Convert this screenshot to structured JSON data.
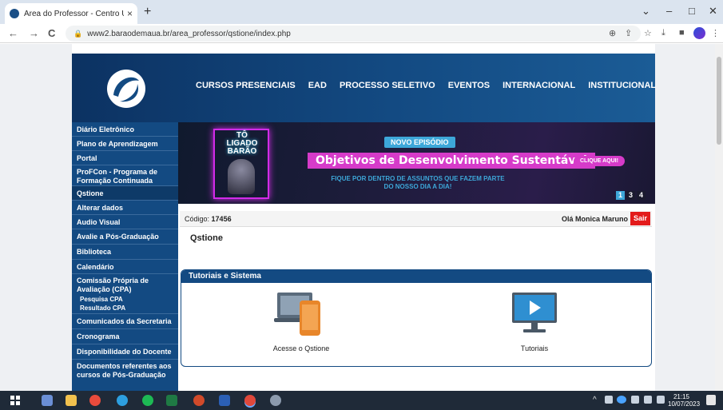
{
  "browser": {
    "tab_title": "Área do Professor - Centro Unive",
    "tab_close": "×",
    "new_tab": "+",
    "url": "www2.baraodemaua.br/area_professor/qstione/index.php",
    "window_controls": {
      "chevron": "⌄",
      "minimize": "–",
      "maximize": "□",
      "close": "✕"
    },
    "nav": {
      "back": "←",
      "forward": "→",
      "reload": "C"
    },
    "toolbar_icons": {
      "zoom": "⊕",
      "share": "⇪",
      "star": "☆",
      "download": "⤓",
      "sidepanel": "■",
      "menu": "⋮"
    }
  },
  "header": {
    "nav_items": [
      "CURSOS PRESENCIAIS",
      "EAD",
      "PROCESSO SELETIVO",
      "EVENTOS",
      "INTERNACIONAL",
      "INSTITUCIONAL"
    ]
  },
  "sidebar": {
    "items": [
      {
        "label": "Diário Eletrônico",
        "type": "item"
      },
      {
        "label": "Plano de Aprendizagem",
        "type": "item"
      },
      {
        "label": "Portal",
        "type": "item"
      },
      {
        "label": "ProFCon - Programa de Formação Continuada",
        "type": "item"
      },
      {
        "label": "Qstione",
        "type": "item",
        "selected": true
      },
      {
        "label": "Alterar dados",
        "type": "item"
      },
      {
        "label": "Audio Visual",
        "type": "item"
      },
      {
        "label": "Avalie a Pós-Graduação",
        "type": "item"
      },
      {
        "label": "Biblioteca",
        "type": "item"
      },
      {
        "label": "Calendário",
        "type": "item"
      },
      {
        "label": "Comissão Própria de Avaliação (CPA)",
        "type": "item"
      },
      {
        "label": "Pesquisa CPA",
        "type": "sub"
      },
      {
        "label": "Resultado CPA",
        "type": "sub"
      },
      {
        "label": "Comunicados da Secretaria",
        "type": "item"
      },
      {
        "label": "Cronograma",
        "type": "item"
      },
      {
        "label": "Disponibilidade do Docente",
        "type": "item"
      },
      {
        "label": "Documentos referentes aos cursos de Pós-Graduação",
        "type": "item"
      }
    ]
  },
  "banner": {
    "show_title": "TÔ LIGADO BARÃO",
    "badge": "NOVO EPISÓDIO",
    "headline": "Objetivos de Desenvolvimento Sustentável",
    "subline": "FIQUE POR DENTRO DE ASSUNTOS QUE FAZEM PARTE DO NOSSO DIA A DIA!",
    "cta": "CLIQUE AQUI!",
    "pager": [
      "1",
      "3",
      "4"
    ]
  },
  "content": {
    "codigo_label": "Código:",
    "codigo_value": "17456",
    "greeting": "Olá Monica Maruno",
    "logout": "Sair",
    "page_title": "Qstione",
    "panel_title": "Tutoriais e Sistema",
    "tiles": [
      {
        "label": "Acesse o Qstione"
      },
      {
        "label": "Tutoriais"
      }
    ]
  },
  "taskbar": {
    "time": "21:15",
    "date": "10/07/2023",
    "tray_caret": "^"
  },
  "colors": {
    "brand_blue": "#134a82",
    "header_dark": "#0c3262",
    "accent_magenta": "#d63bc9",
    "accent_cyan": "#3da7d9",
    "logout_red": "#e31b1b"
  }
}
